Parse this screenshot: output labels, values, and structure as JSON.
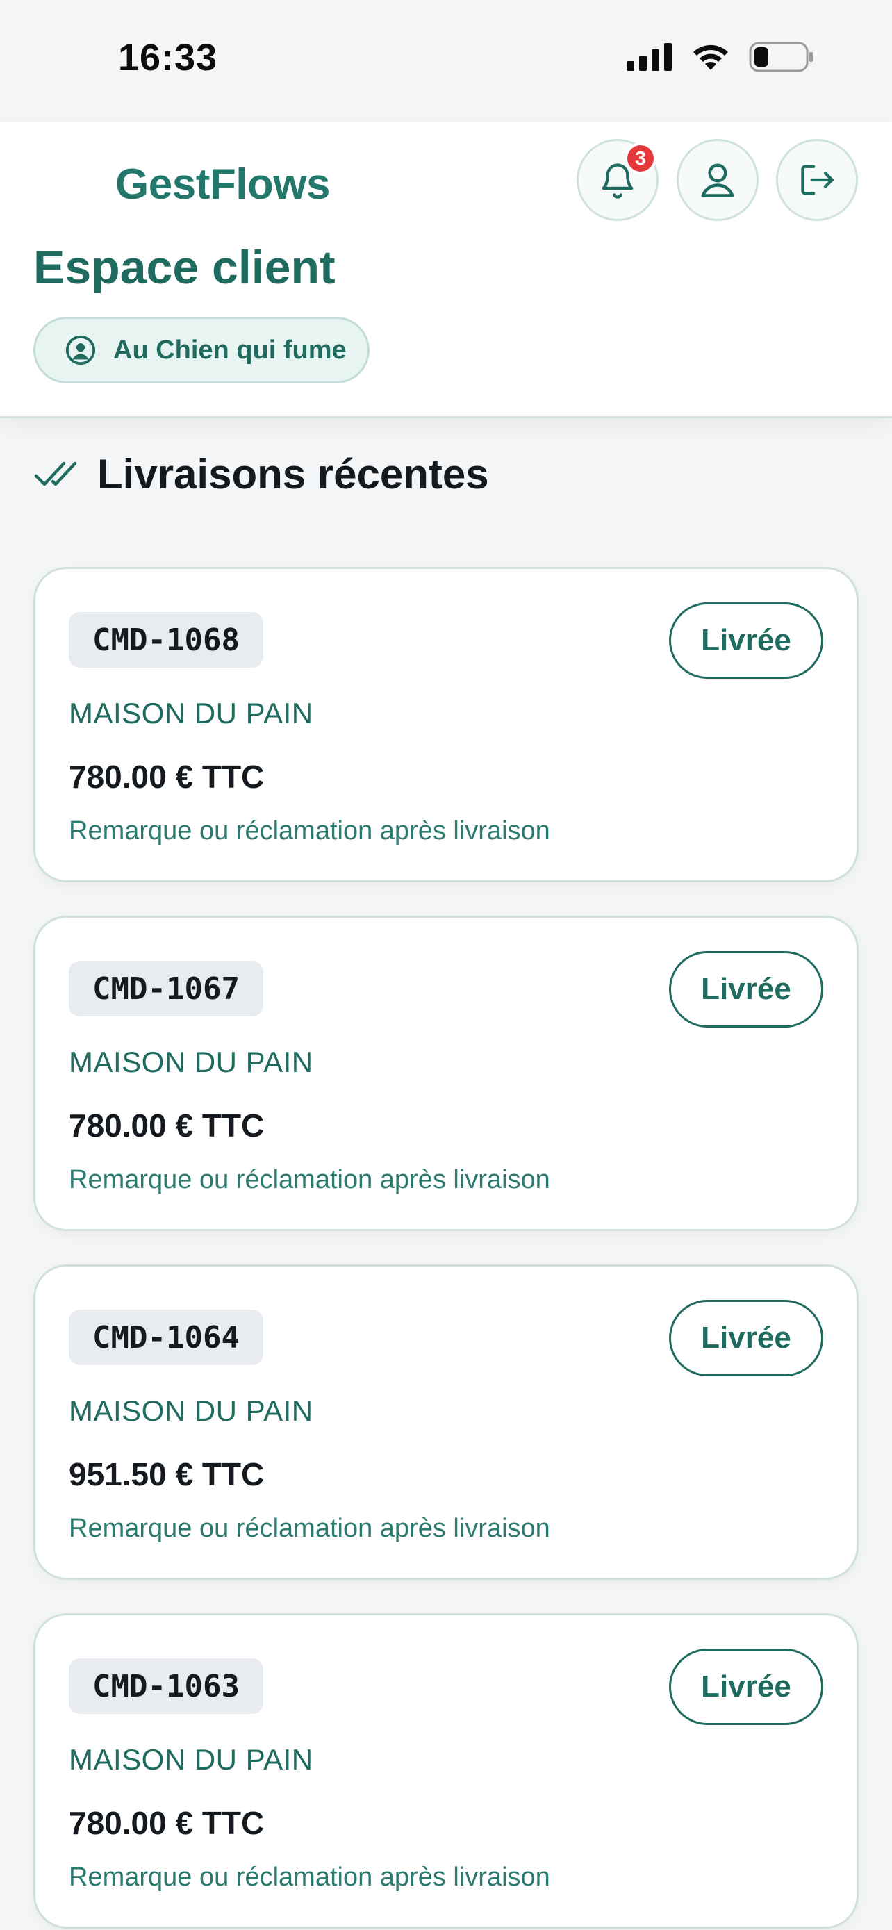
{
  "status_bar": {
    "time": "16:33"
  },
  "header": {
    "brand": "GestFlows",
    "notification_count": "3",
    "page_title": "Espace client",
    "client_name": "Au Chien qui fume"
  },
  "section": {
    "title": "Livraisons récentes"
  },
  "orders": [
    {
      "id": "CMD-1068",
      "status": "Livrée",
      "supplier": "MAISON DU PAIN",
      "amount": "780.00 € TTC",
      "remark": "Remarque ou réclamation après livraison"
    },
    {
      "id": "CMD-1067",
      "status": "Livrée",
      "supplier": "MAISON DU PAIN",
      "amount": "780.00 € TTC",
      "remark": "Remarque ou réclamation après livraison"
    },
    {
      "id": "CMD-1064",
      "status": "Livrée",
      "supplier": "MAISON DU PAIN",
      "amount": "951.50 € TTC",
      "remark": "Remarque ou réclamation après livraison"
    },
    {
      "id": "CMD-1063",
      "status": "Livrée",
      "supplier": "MAISON DU PAIN",
      "amount": "780.00 € TTC",
      "remark": "Remarque ou réclamation après livraison"
    }
  ],
  "icons": {
    "notifications": "bell-icon",
    "profile": "user-icon",
    "logout": "logout-icon",
    "client": "user-circle-icon",
    "section": "double-check-icon"
  },
  "colors": {
    "accent": "#1f6b60",
    "brand": "#24786b",
    "badge": "#e5383b",
    "background": "#f3f5f7"
  }
}
